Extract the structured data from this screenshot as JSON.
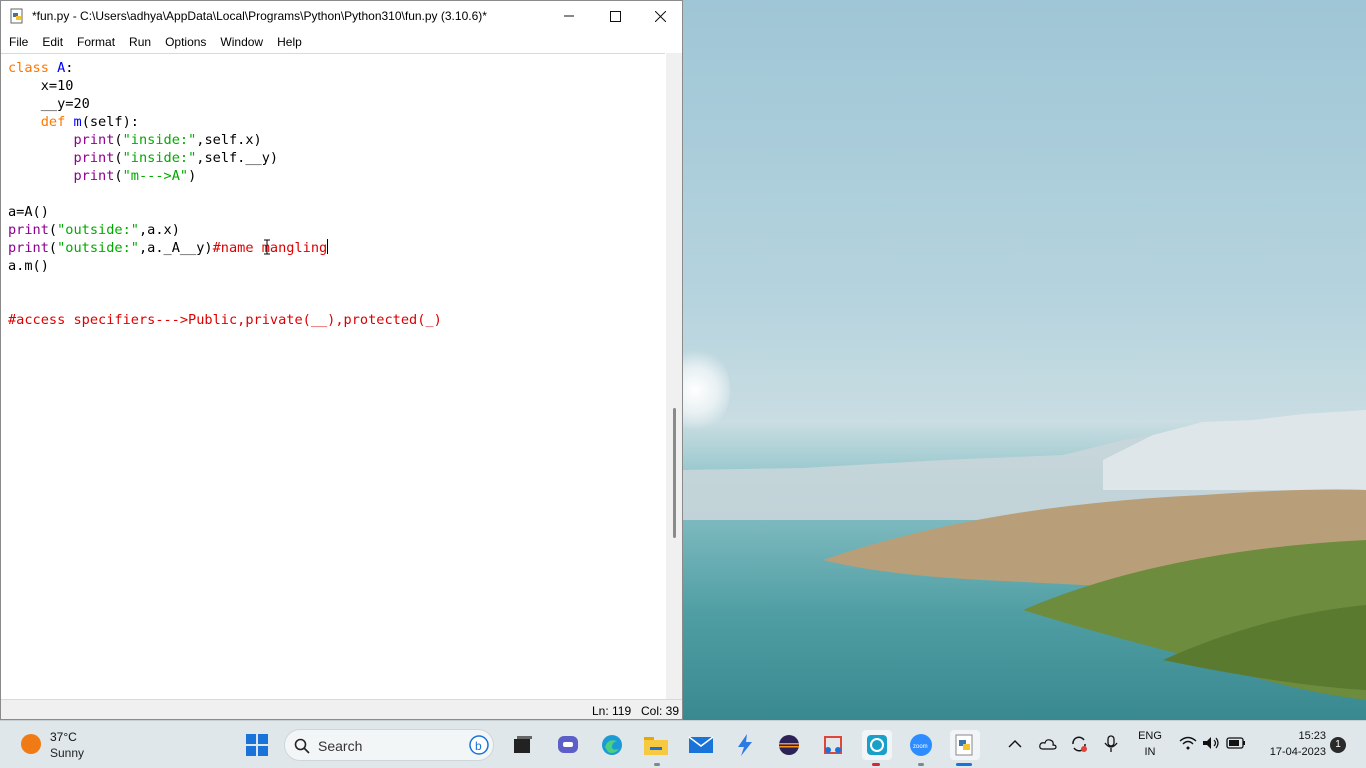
{
  "window": {
    "title": "*fun.py - C:\\Users\\adhya\\AppData\\Local\\Programs\\Python\\Python310\\fun.py (3.10.6)*",
    "menu": [
      "File",
      "Edit",
      "Format",
      "Run",
      "Options",
      "Window",
      "Help"
    ]
  },
  "code_lines": [
    "class A:",
    "    x=10",
    "    __y=20",
    "    def m(self):",
    "        print(\"inside:\",self.x)",
    "        print(\"inside:\",self.__y)",
    "        print(\"m--->A\")",
    "",
    "a=A()",
    "print(\"outside:\",a.x)",
    "print(\"outside:\",a._A__y)#name mangling",
    "a.m()",
    "",
    "",
    "#access specifiers--->Public,private(__),protected(_)"
  ],
  "status": {
    "line": "Ln: 119",
    "col": "Col: 39"
  },
  "taskbar": {
    "weather_temp": "37°C",
    "weather_desc": "Sunny",
    "search_placeholder": "Search",
    "lang_top": "ENG",
    "lang_bottom": "IN",
    "time": "15:23",
    "date": "17-04-2023",
    "notification_count": "1"
  }
}
